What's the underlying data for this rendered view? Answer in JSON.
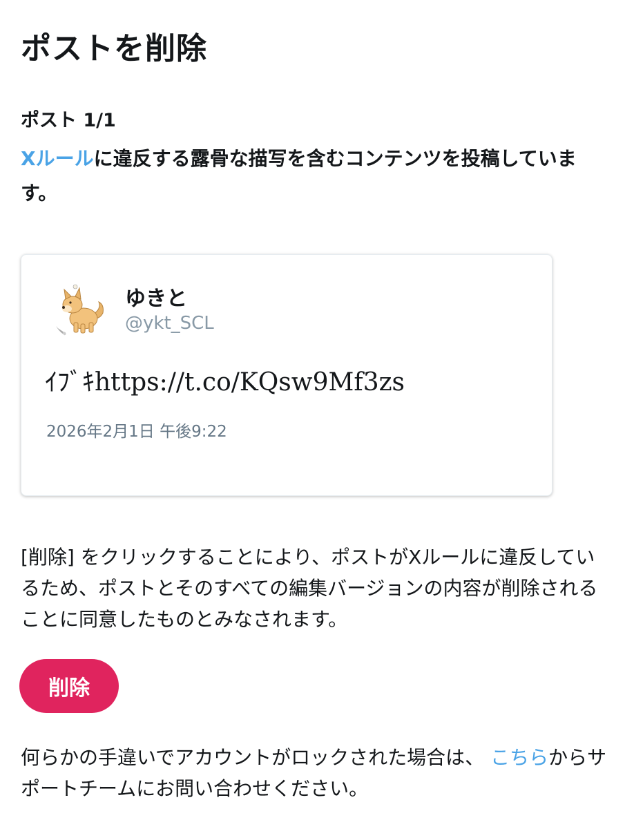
{
  "page": {
    "title": "ポストを削除"
  },
  "post_counter": "ポスト 1/1",
  "violation": {
    "rules_link": "Xルール",
    "message": "に違反する露骨な描写を含むコンテンツを投稿しています。"
  },
  "tweet": {
    "author_name": "ゆきと",
    "author_handle": "@ykt_SCL",
    "text": "ｲﾌﾞｷhttps://t.co/KQsw9Mf3zs",
    "date": "2026年2月1日 午後9:22",
    "avatar_icon": "shiba-dog-avatar-icon"
  },
  "consent_text": "[削除] をクリックすることにより、ポストがXルールに違反しているため、ポストとそのすべての編集バージョンの内容が削除されることに同意したものとみなされます。",
  "delete_button": {
    "label": "削除",
    "color": "#e0245e"
  },
  "support": {
    "text": "何らかの手違いでアカウントがロックされた場合は、",
    "link": "こちら",
    "text_after": "からサポートチームにお問い合わせください。"
  },
  "colors": {
    "link": "#4aa3e6",
    "text": "#14171a",
    "secondary_text": "#8899a6"
  }
}
